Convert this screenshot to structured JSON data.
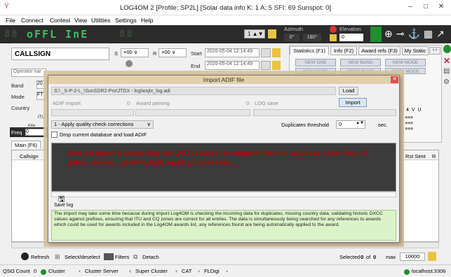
{
  "window": {
    "title": "LOG4OM 2 [Profile: SP2L] [Solar data info K: 1 A: 5 SFI: 69 Sunspot: 0]",
    "minimize": "–",
    "maximize": "□",
    "close": "✕"
  },
  "menu": [
    "File",
    "Connect",
    "Contest",
    "View",
    "Utilities",
    "Settings",
    "Help"
  ],
  "toolbar": {
    "display_on": "oFFL InE",
    "display_dim_left": "88",
    "display_dim_right": "88",
    "step_value": "1",
    "azimuth_label": "Azimuth",
    "azimuth_values": [
      "0°",
      "180°"
    ],
    "elevation_label": "Elevation",
    "elevation_value": "0"
  },
  "entry": {
    "callsign_label": "CALLSIGN",
    "s_label": "S",
    "s_value": "+00",
    "r_label": "R",
    "r_value": "+00",
    "start_label": "Start",
    "start_value": "2020-05-04 12:14:49",
    "end_label": "End",
    "end_value": "2020-05-04 12:14:49",
    "operator_placeholder": "Operator nar",
    "band_label": "Band",
    "band_value": "20",
    "mode_label": "Mode",
    "mode_value": "FT",
    "country_label": "Country",
    "itu_label": "ITU",
    "khz_label": "KHz",
    "freq_label": "Freq",
    "freq_value": "0"
  },
  "right_tabs": [
    "Statistics (F1)",
    "Info (F2)",
    "Award refs (F3)",
    "My Static"
  ],
  "stat_buttons": [
    "NEW ONE",
    "NEW BAND",
    "NEW MODE"
  ],
  "stat_buttons_row2": [
    "NEW CQZN",
    "CQZN BAND",
    "CQZN MODE"
  ],
  "spot_cols": "4 V U",
  "lower_tabs": [
    "Main (F6)"
  ],
  "grid_headers": {
    "callsign": "Callsign",
    "rst_sent": "Rst Sent",
    "rst_rcvd": "R"
  },
  "import_dialog": {
    "title": "Import ADIF file",
    "close": "✕",
    "file_path": "S:\\ _S-P-2-L_\\SunSDR2-Pro\\JTDX - log\\wsjtx_log.adi",
    "load_button": "Load",
    "import_button": "Import",
    "adif_import_label": "ADIF import",
    "adif_import_value": "0",
    "award_parsing_label": "Award parsing",
    "award_parsing_value": "0",
    "log_save_label": "LOG save",
    "quality_select": "1 - Apply quality check corrections",
    "duplicates_label": "Duplicates threshold",
    "duplicates_value": "0",
    "sec_label": "sec.",
    "drop_label": "Drop current database and load ADIF",
    "console_message": "Now, we have file comprising our QSO's ready to be imported into our database. Click \"Import\" button and wait patiently untill import process ends...",
    "save_log_label": "Save log",
    "info_text": "The import may take some time because during import Log4OM is checking the incoming data for duplicates, missing country data, validating historic DXCC values against prefixes, ensuring that ITU and CQ zones are correct for all entries. The data is simultaneously being searched for any references to awards which could be used for awards included in the Log4OM awards list, any references found are being automatically applied to the award."
  },
  "bottom_toolbar": {
    "refresh": "Refresh",
    "select": "Select/deselect",
    "filters": "Filters",
    "detach": "Detach",
    "selected_label": "Selected",
    "selected_count": "0",
    "of_label": "of",
    "total_count": "0",
    "max_label": "max",
    "max_value": "10000"
  },
  "status": {
    "qso_count": "QSO Count",
    "qso_value": "0",
    "cluster": "Cluster",
    "cluster_server": "Cluster Server",
    "super_cluster": "Super Cluster",
    "cat": "CAT",
    "fldigi": "FLDigi",
    "localhost": "localhost:3306"
  }
}
